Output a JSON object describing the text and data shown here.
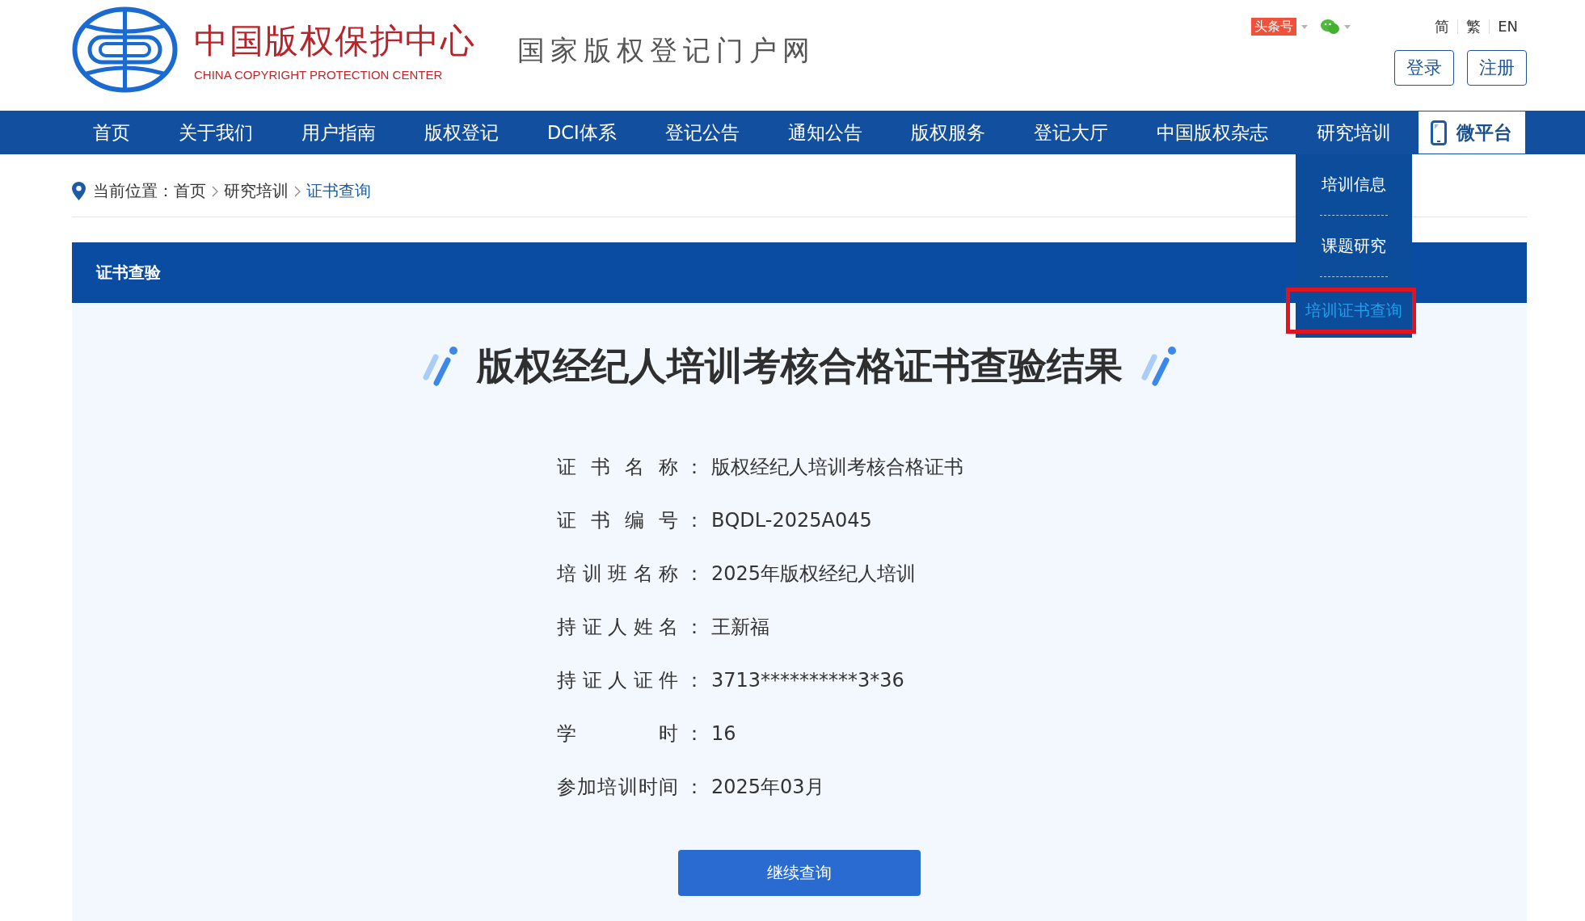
{
  "header": {
    "logo_title": "中国版权保护中心",
    "logo_subtitle": "CHINA COPYRIGHT PROTECTION CENTER",
    "portal_name": "国家版权登记门户网",
    "social": [
      {
        "kind": "badge",
        "label": "头条号"
      },
      {
        "kind": "wechat"
      }
    ],
    "languages": [
      "简",
      "繁",
      "EN"
    ],
    "buttons": [
      "登录",
      "注册"
    ]
  },
  "nav": {
    "items": [
      {
        "label": "首页"
      },
      {
        "label": "关于我们"
      },
      {
        "label": "用户指南"
      },
      {
        "label": "版权登记"
      },
      {
        "label": "DCI体系"
      },
      {
        "label": "登记公告"
      },
      {
        "label": "通知公告"
      },
      {
        "label": "版权服务"
      },
      {
        "label": "登记大厅"
      },
      {
        "label": "中国版权杂志"
      },
      {
        "label": "研究培训",
        "menu": [
          {
            "label": "培训信息",
            "selected": false,
            "marked": false
          },
          {
            "label": "课题研究",
            "selected": false,
            "marked": false
          },
          {
            "label": "培训证书查询",
            "selected": true,
            "marked": true
          }
        ]
      }
    ],
    "mobile": "微平台"
  },
  "breadcrumb": {
    "label": "当前位置：",
    "items": [
      {
        "label": "首页",
        "selected": false
      },
      {
        "label": "研究培训",
        "selected": false
      },
      {
        "label": "证书查询",
        "selected": true
      }
    ]
  },
  "section_title": "证书查验",
  "result": {
    "title": "版权经纪人培训考核合格证书查验结果",
    "rows": [
      {
        "label": "证书名称",
        "separator": "：",
        "value": "版权经纪人培训考核合格证书"
      },
      {
        "label": "证书编号",
        "separator": "：",
        "value": "BQDL-2025A045"
      },
      {
        "label": "培训班名称",
        "separator": "：",
        "value": "2025年版权经纪人培训"
      },
      {
        "label": "持证人姓名",
        "separator": "：",
        "value": "王新福"
      },
      {
        "label": "持证人证件",
        "separator": "：",
        "value": "3713**********3*36"
      },
      {
        "label": "学时",
        "separator": "：",
        "value": "16"
      },
      {
        "label": "参加培训时间",
        "separator": "：",
        "value": "2025年03月"
      }
    ],
    "button": "继续查询"
  }
}
